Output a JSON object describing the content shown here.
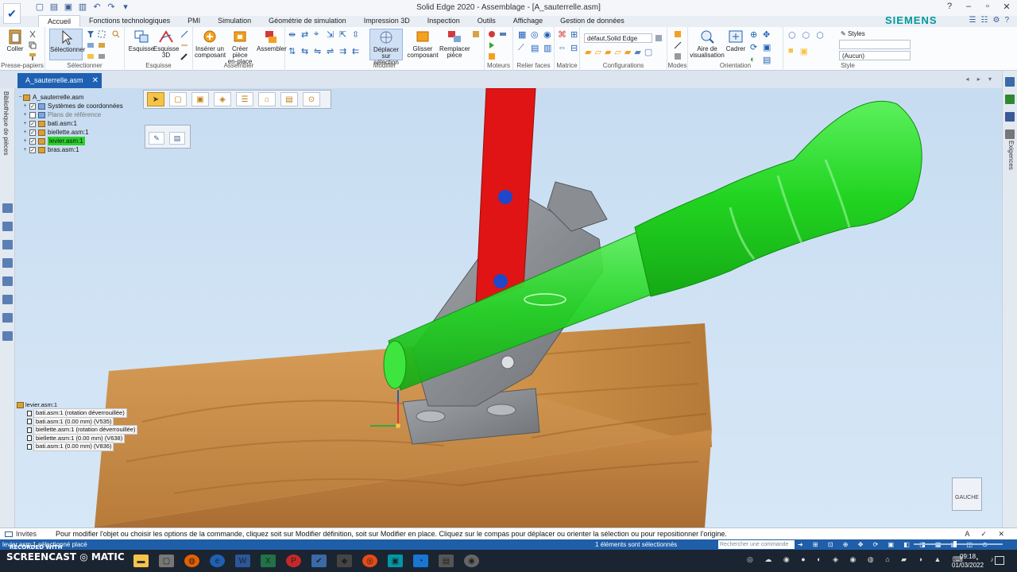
{
  "window": {
    "title": "Solid Edge 2020 - Assemblage - [A_sauterrelle.asm]",
    "brand": "SIEMENS",
    "controls": [
      "–",
      "▫",
      "✕"
    ]
  },
  "tabs": [
    {
      "label": "Accueil",
      "active": true
    },
    {
      "label": "Fonctions technologiques"
    },
    {
      "label": "PMI"
    },
    {
      "label": "Simulation"
    },
    {
      "label": "Géométrie de simulation"
    },
    {
      "label": "Impression 3D"
    },
    {
      "label": "Inspection"
    },
    {
      "label": "Outils"
    },
    {
      "label": "Affichage"
    },
    {
      "label": "Gestion de données"
    }
  ],
  "ribbon": {
    "groups": {
      "clipboard": "Presse-papiers",
      "select": "Sélectionner",
      "sketch": "Esquisse",
      "assemble": "Assembler",
      "modify": "Modifier",
      "motors": "Moteurs",
      "link_faces": "Relier faces",
      "pattern": "Matrice",
      "configurations": "Configurations",
      "modes": "Modes",
      "orientation": "Orientation",
      "style": "Style"
    },
    "buttons": {
      "paste": "Coller",
      "select": "Sélectionner",
      "sketch": "Esquisse",
      "sketch3d": "Esquisse 3D",
      "insert_component_1": "Insérer un",
      "insert_component_2": "composant",
      "create_part_1": "Créer pièce",
      "create_part_2": "en-place",
      "assemble": "Assembler",
      "move_selection_1": "Déplacer sur",
      "move_selection_2": "sélection",
      "drag_component_1": "Glisser",
      "drag_component_2": "composant",
      "replace_part_1": "Remplacer",
      "replace_part_2": "pièce",
      "view_area_1": "Aire de",
      "view_area_2": "visualisation",
      "fit": "Cadrer",
      "styles": "Styles"
    },
    "config_value": "défaut,Solid Edge",
    "style_value": "(Aucun)"
  },
  "document": {
    "tab_label": "A_sauterrelle.asm",
    "close": "✕"
  },
  "left_rail": {
    "label": "Bibliothèque de pièces"
  },
  "right_rail": {
    "label": "Exigences"
  },
  "tree": {
    "root": "A_sauterrelle.asm",
    "items": [
      {
        "label": "Systèmes de coordonnées",
        "checked": true
      },
      {
        "label": "Plans de référence",
        "checked": false,
        "dim": true
      },
      {
        "label": "bati.asm:1",
        "checked": true
      },
      {
        "label": "biellette.asm:1",
        "checked": true
      },
      {
        "label": "levier.asm:1",
        "checked": true,
        "selected": true
      },
      {
        "label": "bras.asm:1",
        "checked": true
      }
    ]
  },
  "relations": {
    "head": "levier.asm:1",
    "rows": [
      "bati.asm:1  (rotation déverrouillée)",
      "bati.asm:1  (0.00 mm)  (V535)",
      "biellette.asm:1  (rotation déverrouillée)",
      "biellette.asm:1  (0.00 mm)  (V638)",
      "bati.asm:1  (0.00 mm)  (V836)"
    ]
  },
  "view_cube": {
    "label": "GAUCHE"
  },
  "prompt": {
    "invites_label": "Invites",
    "message": "Pour modifier l'objet ou choisir les options de la commande, cliquez soit sur Modifier définition, soit sur Modifier en place. Cliquez sur le compas pour déplacer ou orienter la sélection ou pour repositionner l'origine."
  },
  "status": {
    "left": "levier.asm:1 sélectionné placé",
    "center": "1 éléments sont sélectionnés",
    "search_placeholder": "Rechercher une commande"
  },
  "taskbar": {
    "watermark_top": "RECORDED WITH",
    "watermark": "SCREENCAST ◎ MATIC",
    "time": "09:18",
    "date": "01/03/2022"
  },
  "colors": {
    "accent": "#1e61b3",
    "selection_green": "#2bd12b",
    "lever_red": "#e01414",
    "wood": "#c88b45"
  }
}
